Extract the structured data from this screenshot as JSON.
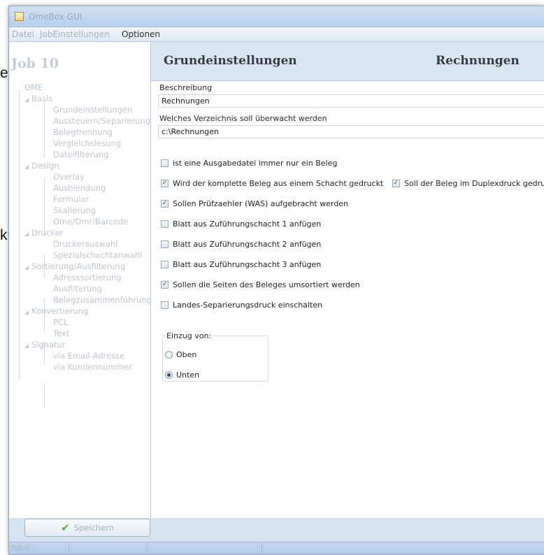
{
  "background": {
    "fragment_1": "en",
    "fragment_2": "ku-"
  },
  "window": {
    "title": "OmeBox GUI"
  },
  "menu": {
    "items": [
      "Datei",
      "JobEinstellungen",
      "Optionen"
    ]
  },
  "left_panel": {
    "job_title": "Job 10",
    "tree": {
      "root": "OME",
      "groups": [
        {
          "label": "Basis",
          "items": [
            "Grundeinstellungen",
            "Aussteuern/Separierung",
            "Belegtrennung",
            "Vergleichslesung",
            "Dateifilterung"
          ]
        },
        {
          "label": "Design",
          "items": [
            "Overlay",
            "Ausblendung",
            "Formular",
            "Skalierung",
            "Ome/Omr/Barcode"
          ]
        },
        {
          "label": "Drucker",
          "items": [
            "Druckerauswahl",
            "Spezialschachtanwahl"
          ]
        },
        {
          "label": "Sortierung/Ausfilterung",
          "items": [
            "Adresssortierung",
            "Ausfilterung",
            "Belegzusammenführung"
          ]
        },
        {
          "label": "Konvertierung",
          "items": [
            "PCL",
            "Text"
          ]
        },
        {
          "label": "Signatur",
          "items": [
            "via Email-Adresse",
            "via Kundennummer"
          ]
        }
      ]
    }
  },
  "content": {
    "header_left": "Grundeinstellungen",
    "header_right": "Rechnungen",
    "description_label": "Beschreibung",
    "description_value": "Rechnungen",
    "directory_label": "Welches Verzeichnis soll überwacht werden",
    "directory_value": "c:\\Rechnungen",
    "checkboxes": [
      {
        "label": "ist eine Ausgabedatei immer nur ein Beleg",
        "checked": false
      },
      {
        "label": "Wird der komplette Beleg aus einem Schacht gedruckt",
        "checked": true
      },
      {
        "label": "Soll der Beleg im Duplexdruck gedruckt",
        "checked": true
      },
      {
        "label": "Sollen Prüfzaehler (WAS) aufgebracht werden",
        "checked": true
      },
      {
        "label": "Blatt aus Zuführungschacht 1 anfügen",
        "checked": false
      },
      {
        "label": "Blatt aus Zuführungschacht 2 anfügen",
        "checked": false
      },
      {
        "label": "Blatt aus Zuführungschacht 3 anfügen",
        "checked": false
      },
      {
        "label": "Sollen die Seiten des Beleges umsortiert werden",
        "checked": true
      },
      {
        "label": "Landes-Separierungsdruck einschalten",
        "checked": false
      }
    ],
    "feed_group": {
      "title": "Einzug von:",
      "options": [
        {
          "label": "Oben",
          "selected": false
        },
        {
          "label": "Unten",
          "selected": true
        }
      ]
    }
  },
  "footer": {
    "save_label": "Speichern",
    "status_text": "0:0:0"
  },
  "colors": {
    "window_bg": "#d7e3f1",
    "header_text": "#383c42",
    "disabled_text": "#bcc3cc",
    "check_mark": "#2a3f7a",
    "save_check": "#5fae3c"
  }
}
